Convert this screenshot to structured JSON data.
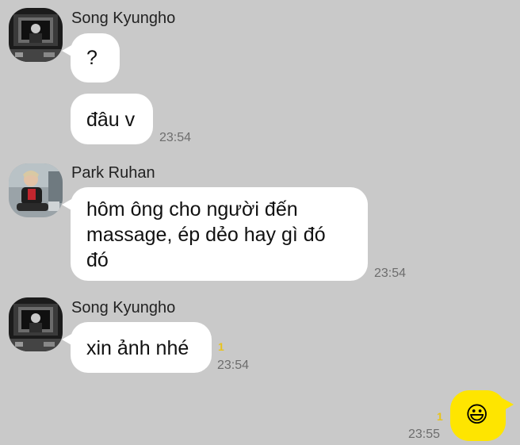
{
  "messages": [
    {
      "sender": "Song Kyungho",
      "text": "?",
      "avatar": "avatar-song-kyungho"
    },
    {
      "text": "đâu v",
      "time": "23:54"
    },
    {
      "sender": "Park Ruhan",
      "lines": [
        "hôm ông cho người đến",
        "massage, ép dẻo hay gì đó",
        "đó"
      ],
      "time": "23:54",
      "avatar": "avatar-park-ruhan"
    },
    {
      "sender": "Song Kyungho",
      "text": "xin ảnh nhé",
      "unread": "1",
      "time": "23:54",
      "avatar": "avatar-song-kyungho"
    },
    {
      "mine": true,
      "emoji": "😃",
      "unread": "1",
      "time": "23:55"
    }
  ],
  "colors": {
    "background": "#c9c9c9",
    "incoming_bubble": "#ffffff",
    "outgoing_bubble": "#fee500",
    "unread_badge": "#e8c31a"
  }
}
